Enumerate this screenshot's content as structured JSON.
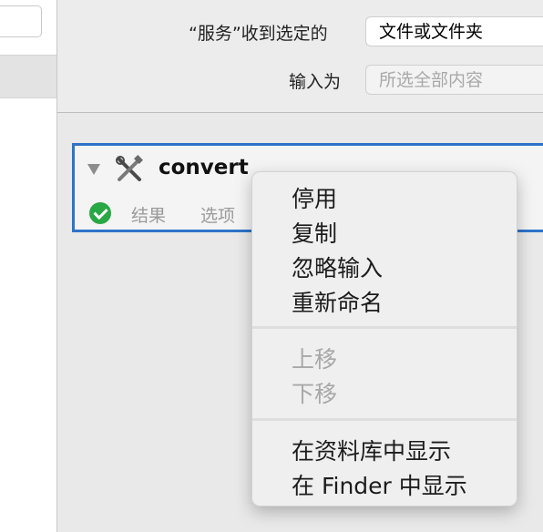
{
  "settings": {
    "service_label": "“服务”收到选定的",
    "service_value": "文件或文件夹",
    "input_label": "输入为",
    "input_value": "所选全部内容"
  },
  "action": {
    "title": "convert",
    "tabs": [
      "结果",
      "选项"
    ]
  },
  "menu": {
    "items": [
      "停用",
      "复制",
      "忽略输入",
      "重新命名"
    ],
    "move_items": [
      "上移",
      "下移"
    ],
    "show_items": [
      "在资料库中显示",
      "在 Finder 中显示"
    ]
  },
  "colors": {
    "selection_border": "#2f73c9",
    "status_green": "#28a745"
  }
}
